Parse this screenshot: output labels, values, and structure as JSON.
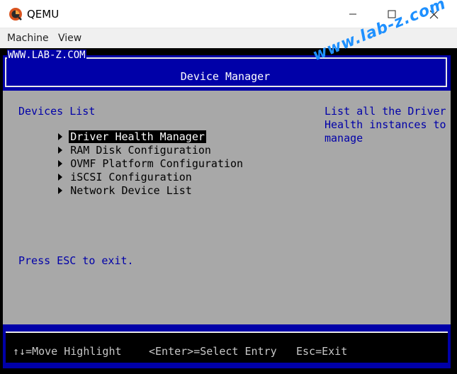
{
  "window": {
    "title": "QEMU",
    "menu": [
      "Machine",
      "View"
    ]
  },
  "header": {
    "brand": "WWW.LAB-Z.COM",
    "title": "Device Manager"
  },
  "devices": {
    "heading": "Devices List",
    "items": [
      {
        "label": "Driver Health Manager",
        "selected": true
      },
      {
        "label": "RAM Disk Configuration",
        "selected": false
      },
      {
        "label": "OVMF Platform Configuration",
        "selected": false
      },
      {
        "label": "iSCSI Configuration",
        "selected": false
      },
      {
        "label": "Network Device List",
        "selected": false
      }
    ],
    "esc_hint": "Press ESC to exit."
  },
  "help": {
    "lines": [
      "List all the Driver",
      "Health instances to",
      "manage"
    ]
  },
  "footer": {
    "move": "↑↓=Move Highlight",
    "select": "<Enter>=Select Entry",
    "exit": "Esc=Exit"
  },
  "watermark": "www.lab-z.com",
  "colors": {
    "bios_blue": "#0000a8",
    "bios_gray": "#a8a8a8",
    "watermark": "#1e90ff"
  }
}
